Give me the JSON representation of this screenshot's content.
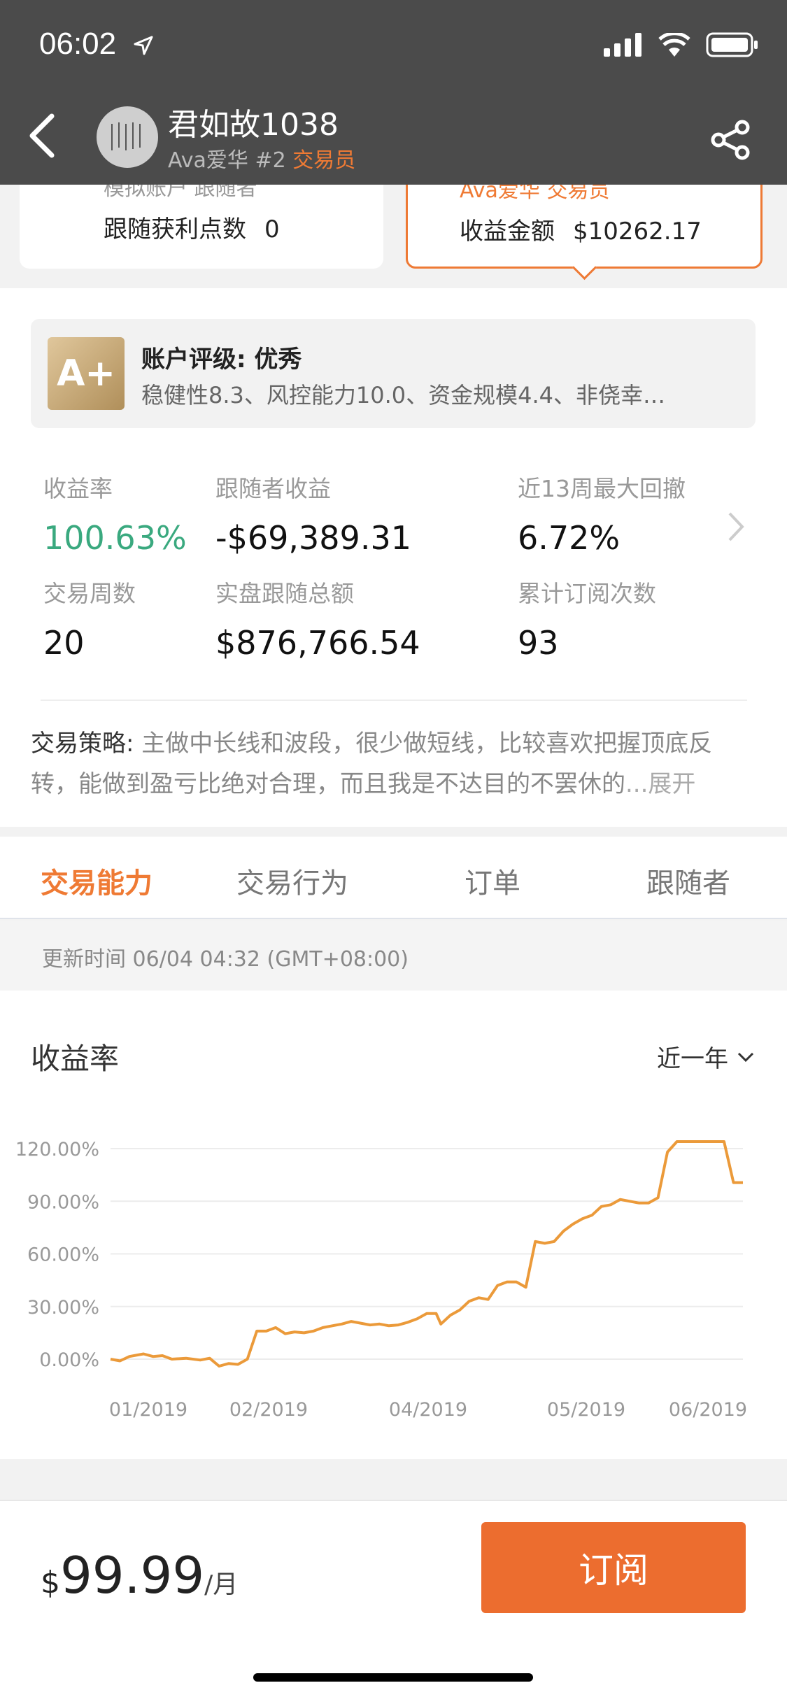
{
  "status": {
    "time": "06:02"
  },
  "header": {
    "name": "君如故1038",
    "org": "Ava爱华",
    "rank": "#2",
    "role": "交易员"
  },
  "cards": {
    "left": {
      "small": "模拟账户 跟随者",
      "label": "跟随获利点数",
      "value": "0"
    },
    "right": {
      "small": "Ava爱华 交易员",
      "label": "收益金额",
      "value": "$10262.17"
    }
  },
  "rating": {
    "badge": "A+",
    "title": "账户评级: 优秀",
    "desc": "稳健性8.3、风控能力10.0、资金规模4.4、非侥幸…"
  },
  "stats": [
    {
      "label": "收益率",
      "value": "100.63%"
    },
    {
      "label": "跟随者收益",
      "value": "-$69,389.31"
    },
    {
      "label": "近13周最大回撤",
      "value": "6.72%"
    },
    {
      "label": "交易周数",
      "value": "20"
    },
    {
      "label": "实盘跟随总额",
      "value": "$876,766.54"
    },
    {
      "label": "累计订阅次数",
      "value": "93"
    }
  ],
  "strategy": {
    "key": "交易策略:",
    "text": " 主做中长线和波段，很少做短线，比较喜欢把握顶底反转，能做到盈亏比绝对合理，而且我是不达目的不罢休的",
    "more": "...展开"
  },
  "tabs": [
    "交易能力",
    "交易行为",
    "订单",
    "跟随者"
  ],
  "update_time": "更新时间 06/04 04:32 (GMT+08:00)",
  "chart_header": {
    "title": "收益率",
    "range": "近一年"
  },
  "chart_data": {
    "type": "line",
    "x": [
      "01/2019",
      "02/2019",
      "04/2019",
      "05/2019",
      "06/2019"
    ],
    "ytick_labels": [
      "120.00%",
      "90.00%",
      "60.00%",
      "30.00%",
      "0.00%"
    ],
    "ylim": [
      -10,
      125
    ],
    "points": [
      [
        0,
        0
      ],
      [
        0.02,
        -1
      ],
      [
        0.04,
        1.5
      ],
      [
        0.07,
        3
      ],
      [
        0.09,
        1.5
      ],
      [
        0.11,
        2
      ],
      [
        0.13,
        0
      ],
      [
        0.16,
        0.5
      ],
      [
        0.19,
        -0.5
      ],
      [
        0.21,
        0.5
      ],
      [
        0.23,
        -4
      ],
      [
        0.25,
        -2.5
      ],
      [
        0.27,
        -3
      ],
      [
        0.29,
        0
      ],
      [
        0.31,
        16
      ],
      [
        0.33,
        16
      ],
      [
        0.35,
        18
      ],
      [
        0.37,
        14.5
      ],
      [
        0.39,
        15.5
      ],
      [
        0.41,
        15
      ],
      [
        0.43,
        16
      ],
      [
        0.45,
        18
      ],
      [
        0.47,
        19
      ],
      [
        0.49,
        20
      ],
      [
        0.51,
        21.5
      ],
      [
        0.53,
        20.5
      ],
      [
        0.55,
        19.5
      ],
      [
        0.57,
        20
      ],
      [
        0.59,
        19
      ],
      [
        0.61,
        19.5
      ],
      [
        0.63,
        21
      ],
      [
        0.65,
        23
      ],
      [
        0.67,
        26
      ],
      [
        0.69,
        26
      ],
      [
        0.7,
        20
      ],
      [
        0.72,
        25
      ],
      [
        0.74,
        28
      ],
      [
        0.76,
        33
      ],
      [
        0.78,
        35
      ],
      [
        0.8,
        34
      ],
      [
        0.82,
        42
      ],
      [
        0.84,
        44
      ],
      [
        0.86,
        44
      ],
      [
        0.88,
        41
      ],
      [
        0.9,
        67
      ],
      [
        0.92,
        66
      ],
      [
        0.94,
        67
      ],
      [
        0.96,
        73
      ],
      [
        0.98,
        77
      ],
      [
        1.0,
        80
      ],
      [
        1.02,
        82
      ],
      [
        1.04,
        87
      ],
      [
        1.06,
        88
      ],
      [
        1.08,
        91
      ],
      [
        1.1,
        90
      ],
      [
        1.12,
        89
      ],
      [
        1.14,
        89
      ],
      [
        1.16,
        92
      ],
      [
        1.18,
        118
      ],
      [
        1.2,
        124
      ],
      [
        1.22,
        124
      ],
      [
        1.24,
        124
      ],
      [
        1.26,
        124
      ],
      [
        1.28,
        124
      ],
      [
        1.3,
        124
      ],
      [
        1.32,
        100.63
      ],
      [
        1.34,
        100.63
      ]
    ]
  },
  "bottom": {
    "currency": "$",
    "price": "99.99",
    "per": "/月",
    "button": "订阅"
  }
}
